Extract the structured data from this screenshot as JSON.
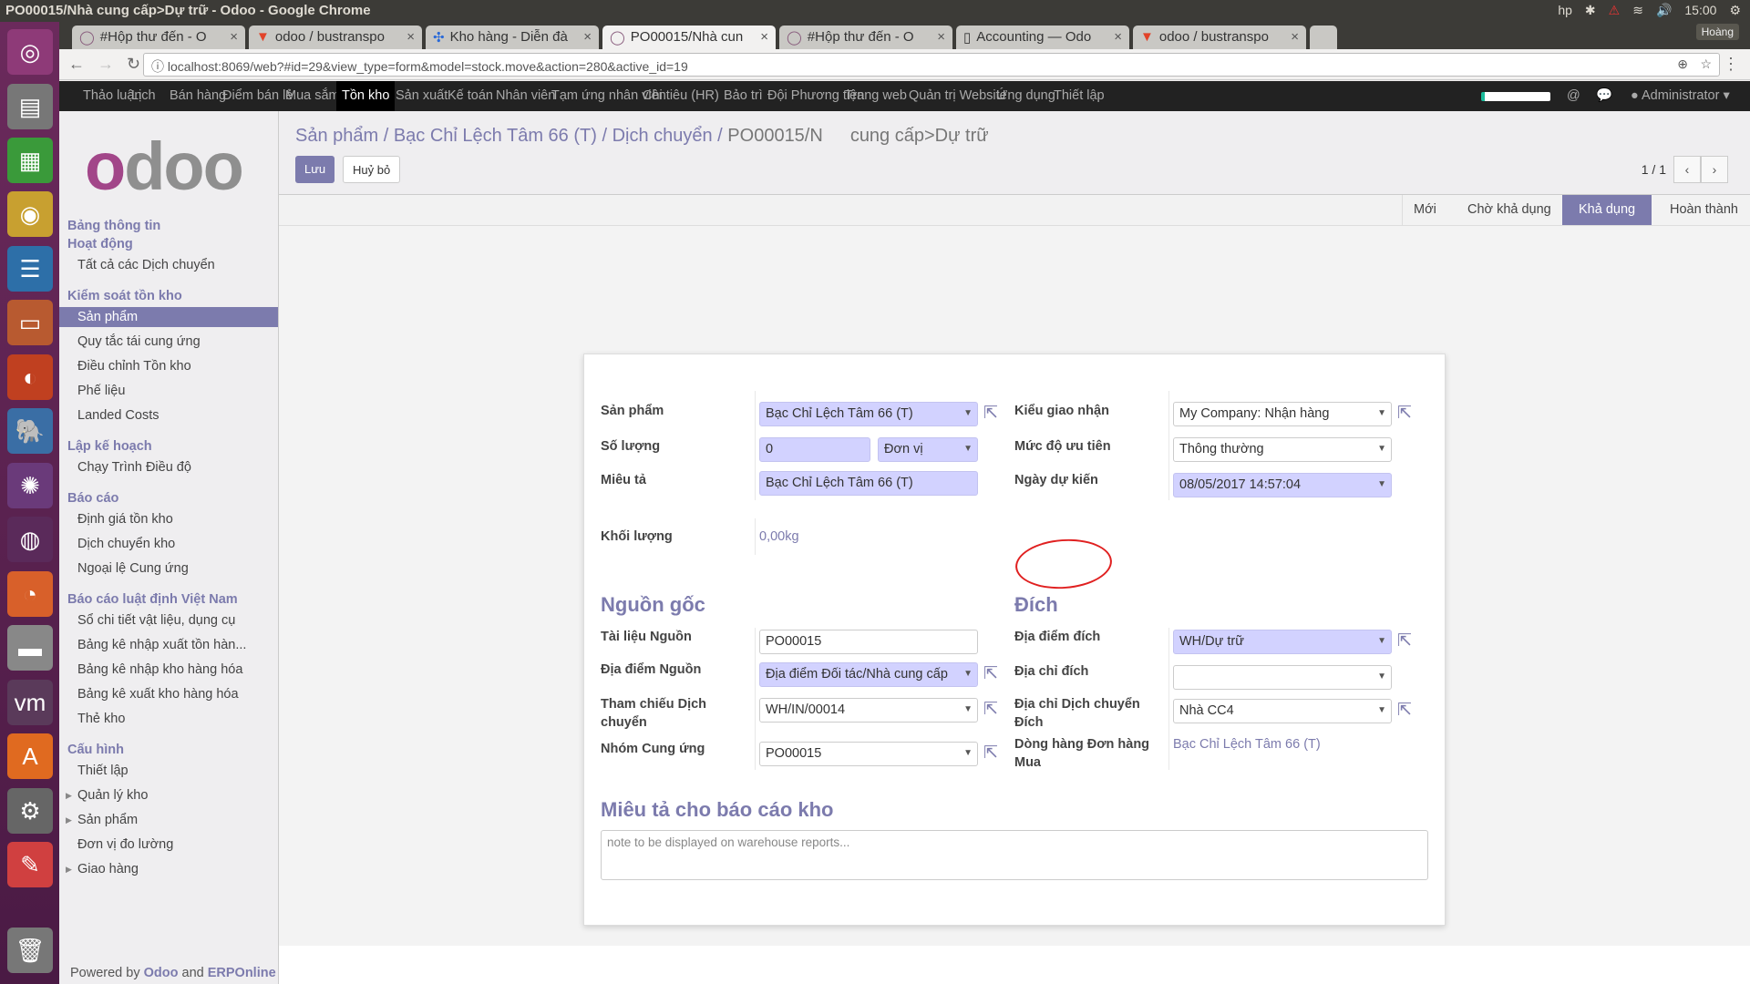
{
  "window": {
    "title": "PO00015/Nhà cung cấp>Dự trữ - Odoo - Google Chrome",
    "time": "15:00",
    "user_chip": "Hoàng"
  },
  "tabs": [
    {
      "label": "#Hộp thư đến - O",
      "icon": "odoo-icon"
    },
    {
      "label": "odoo / bustranspo",
      "icon": "gitlab-icon"
    },
    {
      "label": "Kho hàng - Diễn đà",
      "icon": "forum-icon"
    },
    {
      "label": "PO00015/Nhà cun",
      "icon": "odoo-icon",
      "active": true
    },
    {
      "label": "#Hộp thư đến - O",
      "icon": "odoo-icon"
    },
    {
      "label": "Accounting — Odo",
      "icon": "page-icon"
    },
    {
      "label": "odoo / bustranspo",
      "icon": "gitlab-icon"
    }
  ],
  "address": {
    "url": "localhost:8069/web?#id=29&view_type=form&model=stock.move&action=280&active_id=19"
  },
  "topnav": {
    "items": [
      "Thảo luận",
      "Lịch",
      "Bán hàng",
      "Điểm bán lẻ",
      "Mua sắm",
      "Tồn kho",
      "Sản xuất",
      "Kế toán",
      "Nhân viên",
      "Tạm ứng nhân viên",
      "Chi tiêu (HR)",
      "Bảo trì",
      "Đội Phương tiện",
      "Trang web",
      "Quản trị Website",
      "Ứng dụng",
      "Thiết lập"
    ],
    "active": "Tồn kho",
    "user": "Administrator"
  },
  "sidebar": {
    "logo": "odoo",
    "sections": [
      {
        "title": "Bảng thông tin",
        "items": []
      },
      {
        "title": "Hoạt động",
        "items": [
          "Tất cả các Dịch chuyển"
        ]
      },
      {
        "title": "Kiểm soát tồn kho",
        "items": [
          "Sản phẩm",
          "Quy tắc tái cung ứng",
          "Điều chỉnh Tồn kho",
          "Phế liệu",
          "Landed Costs"
        ]
      },
      {
        "title": "Lập kế hoạch",
        "items": [
          "Chạy Trình Điều độ"
        ]
      },
      {
        "title": "Báo cáo",
        "items": [
          "Định giá tồn kho",
          "Dịch chuyển kho",
          "Ngoại lệ Cung ứng"
        ]
      },
      {
        "title": "Báo cáo luật định Việt Nam",
        "items": [
          "Sổ chi tiết vật liệu, dụng cụ",
          "Bảng kê nhập xuất tồn hàn...",
          "Bảng kê nhập kho hàng hóa",
          "Bảng kê xuất kho hàng hóa",
          "Thẻ kho"
        ]
      },
      {
        "title": "Cấu hình",
        "items": [
          "Thiết lập",
          "Quản lý kho",
          "Sản phẩm",
          "Đơn vị đo lường",
          "Giao hàng"
        ]
      }
    ],
    "active_item": "Sản phẩm",
    "powered": {
      "prefix": "Powered by",
      "odoo": "Odoo",
      "and": "and",
      "erp": "ERPOnline"
    }
  },
  "breadcrumb": {
    "items": [
      "Sản phẩm",
      "Bạc Chỉ Lệch Tâm 66 (T)",
      "Dịch chuyển"
    ],
    "current": "PO00015/N",
    "current_tail": "cung cấp>Dự trữ"
  },
  "buttons": {
    "save": "Lưu",
    "discard": "Huỷ bỏ"
  },
  "pager": {
    "value": "1 / 1"
  },
  "statusbar": {
    "stages": [
      "Mới",
      "Chờ khả dụng",
      "Khả dụng",
      "Hoàn thành"
    ],
    "active": "Khả dụng"
  },
  "form": {
    "product": {
      "label": "Sản phẩm",
      "value": "Bạc Chỉ Lệch Tâm 66 (T)"
    },
    "quantity": {
      "label": "Số lượng",
      "value": "0",
      "uom": "Đơn vị"
    },
    "description": {
      "label": "Miêu tả",
      "value": "Bạc Chỉ Lệch Tâm 66 (T)"
    },
    "weight": {
      "label": "Khối lượng",
      "value": "0,00kg"
    },
    "picking_type": {
      "label": "Kiểu giao nhận",
      "value": "My Company: Nhận hàng"
    },
    "priority": {
      "label": "Mức độ ưu tiên",
      "value": "Thông thường"
    },
    "date_expected": {
      "label": "Ngày dự kiến",
      "value": "08/05/2017 14:57:04"
    },
    "source_title": "Nguồn gốc",
    "dest_title": "Đích",
    "origin": {
      "label": "Tài liệu Nguồn",
      "value": "PO00015"
    },
    "location_src": {
      "label": "Địa điểm Nguồn",
      "value": "Địa điểm Đối tác/Nhà cung cấp"
    },
    "picking": {
      "label": "Tham chiếu Dịch chuyển",
      "value": "WH/IN/00014"
    },
    "group": {
      "label": "Nhóm Cung ứng",
      "value": "PO00015"
    },
    "location_dest": {
      "label": "Địa điểm đích",
      "value": "WH/Dự trữ"
    },
    "partner_dest": {
      "label": "Địa chỉ đích",
      "value": ""
    },
    "move_dest_address": {
      "label": "Địa chỉ Dịch chuyển Đích",
      "value": "Nhà CC4"
    },
    "po_line": {
      "label": "Dòng hàng Đơn hàng Mua",
      "value": "Bạc Chỉ Lệch Tâm 66 (T)"
    },
    "note_title": "Miêu tả cho báo cáo kho",
    "note_placeholder": "note to be displayed on warehouse reports..."
  },
  "colors": {
    "brand": "#7c7bad",
    "required_bg": "#d2d2ff",
    "annotation": "#e02020"
  }
}
